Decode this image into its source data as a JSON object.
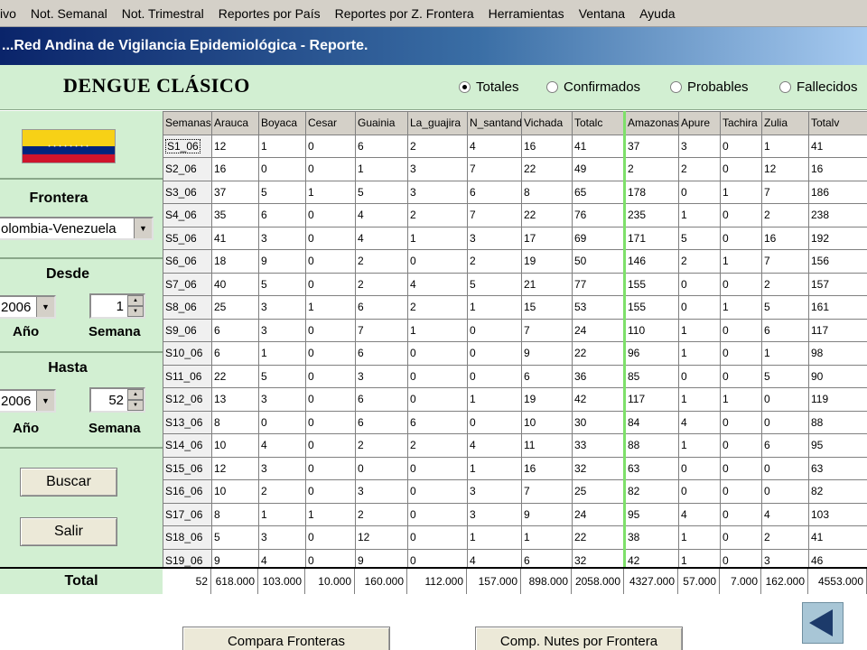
{
  "menu": [
    "ivo",
    "Not. Semanal",
    "Not. Trimestral",
    "Reportes por País",
    "Reportes por Z. Frontera",
    "Herramientas",
    "Ventana",
    "Ayuda"
  ],
  "window": {
    "title": "...Red Andina de Vigilancia Epidemiológica - Reporte."
  },
  "report": {
    "title": "DENGUE CLÁSICO",
    "options": [
      {
        "label": "Totales",
        "checked": true
      },
      {
        "label": "Confirmados",
        "checked": false
      },
      {
        "label": "Probables",
        "checked": false
      },
      {
        "label": "Fallecidos",
        "checked": false
      }
    ]
  },
  "sidebar": {
    "frontera_label": "Frontera",
    "frontera_value": "olombia-Venezuela",
    "desde_label": "Desde",
    "hasta_label": "Hasta",
    "anio_label": "Año",
    "semana_label": "Semana",
    "desde_year": "2006",
    "desde_week": "1",
    "hasta_year": "2006",
    "hasta_week": "52",
    "buscar_label": "Buscar",
    "salir_label": "Salir"
  },
  "colors": {
    "panel_green": "#d2efd2",
    "separator_green": "#7ee06a",
    "title_blue": "#0a246a"
  },
  "grid": {
    "columns": [
      "Semanas",
      "Arauca",
      "Boyaca",
      "Cesar",
      "Guainia",
      "La_guajira",
      "N_santand",
      "Vichada",
      "Totalc",
      "Amazonas",
      "Apure",
      "Tachira",
      "Zulia",
      "Totalv"
    ],
    "rows": [
      [
        "S1_06",
        "12",
        "1",
        "0",
        "6",
        "2",
        "4",
        "16",
        "41",
        "37",
        "3",
        "0",
        "1",
        "41"
      ],
      [
        "S2_06",
        "16",
        "0",
        "0",
        "1",
        "3",
        "7",
        "22",
        "49",
        "2",
        "2",
        "0",
        "12",
        "16"
      ],
      [
        "S3_06",
        "37",
        "5",
        "1",
        "5",
        "3",
        "6",
        "8",
        "65",
        "178",
        "0",
        "1",
        "7",
        "186"
      ],
      [
        "S4_06",
        "35",
        "6",
        "0",
        "4",
        "2",
        "7",
        "22",
        "76",
        "235",
        "1",
        "0",
        "2",
        "238"
      ],
      [
        "S5_06",
        "41",
        "3",
        "0",
        "4",
        "1",
        "3",
        "17",
        "69",
        "171",
        "5",
        "0",
        "16",
        "192"
      ],
      [
        "S6_06",
        "18",
        "9",
        "0",
        "2",
        "0",
        "2",
        "19",
        "50",
        "146",
        "2",
        "1",
        "7",
        "156"
      ],
      [
        "S7_06",
        "40",
        "5",
        "0",
        "2",
        "4",
        "5",
        "21",
        "77",
        "155",
        "0",
        "0",
        "2",
        "157"
      ],
      [
        "S8_06",
        "25",
        "3",
        "1",
        "6",
        "2",
        "1",
        "15",
        "53",
        "155",
        "0",
        "1",
        "5",
        "161"
      ],
      [
        "S9_06",
        "6",
        "3",
        "0",
        "7",
        "1",
        "0",
        "7",
        "24",
        "110",
        "1",
        "0",
        "6",
        "117"
      ],
      [
        "S10_06",
        "6",
        "1",
        "0",
        "6",
        "0",
        "0",
        "9",
        "22",
        "96",
        "1",
        "0",
        "1",
        "98"
      ],
      [
        "S11_06",
        "22",
        "5",
        "0",
        "3",
        "0",
        "0",
        "6",
        "36",
        "85",
        "0",
        "0",
        "5",
        "90"
      ],
      [
        "S12_06",
        "13",
        "3",
        "0",
        "6",
        "0",
        "1",
        "19",
        "42",
        "117",
        "1",
        "1",
        "0",
        "119"
      ],
      [
        "S13_06",
        "8",
        "0",
        "0",
        "6",
        "6",
        "0",
        "10",
        "30",
        "84",
        "4",
        "0",
        "0",
        "88"
      ],
      [
        "S14_06",
        "10",
        "4",
        "0",
        "2",
        "2",
        "4",
        "11",
        "33",
        "88",
        "1",
        "0",
        "6",
        "95"
      ],
      [
        "S15_06",
        "12",
        "3",
        "0",
        "0",
        "0",
        "1",
        "16",
        "32",
        "63",
        "0",
        "0",
        "0",
        "63"
      ],
      [
        "S16_06",
        "10",
        "2",
        "0",
        "3",
        "0",
        "3",
        "7",
        "25",
        "82",
        "0",
        "0",
        "0",
        "82"
      ],
      [
        "S17_06",
        "8",
        "1",
        "1",
        "2",
        "0",
        "3",
        "9",
        "24",
        "95",
        "4",
        "0",
        "4",
        "103"
      ],
      [
        "S18_06",
        "5",
        "3",
        "0",
        "12",
        "0",
        "1",
        "1",
        "22",
        "38",
        "1",
        "0",
        "2",
        "41"
      ],
      [
        "S19_06",
        "9",
        "4",
        "0",
        "9",
        "0",
        "4",
        "6",
        "32",
        "42",
        "1",
        "0",
        "3",
        "46"
      ]
    ],
    "selected_row": 0
  },
  "totals": {
    "label": "Total",
    "values": [
      "52",
      "618.000",
      "103.000",
      "10.000",
      "160.000",
      "112.000",
      "157.000",
      "898.000",
      "2058.000",
      "4327.000",
      "57.000",
      "7.000",
      "162.000",
      "4553.000"
    ]
  },
  "footer": {
    "compara_label": "Compara Fronteras",
    "comp_nutes_label": "Comp. Nutes por Frontera",
    "back_icon": "back-arrow-icon"
  }
}
